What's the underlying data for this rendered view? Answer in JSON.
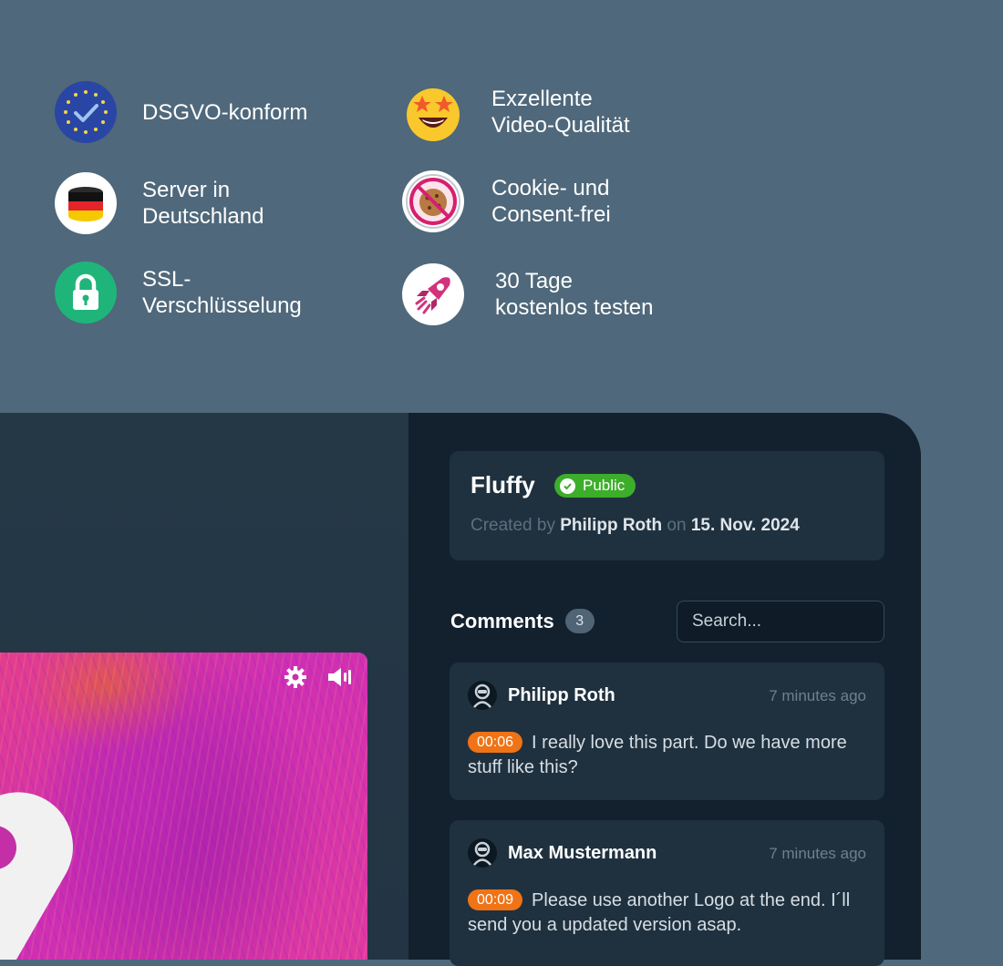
{
  "features": [
    {
      "text": "DSGVO-konform",
      "icon": "eu-shield-icon"
    },
    {
      "text": "Exzellente\nVideo-Qualität",
      "icon": "star-eyes-emoji-icon"
    },
    {
      "text": "Server in\nDeutschland",
      "icon": "german-flag-icon"
    },
    {
      "text": "Cookie- und\nConsent-frei",
      "icon": "no-cookie-icon"
    },
    {
      "text": "SSL-\nVerschlüsselung",
      "icon": "lock-icon"
    },
    {
      "text": "30 Tage\nkostenlos testen",
      "icon": "rocket-icon"
    }
  ],
  "video": {
    "title": "Fluffy",
    "status": "Public",
    "created_prefix": "Created by",
    "author": "Philipp Roth",
    "on": "on",
    "date": "15. Nov. 2024"
  },
  "comments": {
    "label": "Comments",
    "count": "3",
    "search_placeholder": "Search...",
    "items": [
      {
        "author": "Philipp Roth",
        "time": "7 minutes ago",
        "timestamp": "00:06",
        "text": "I really love this part. Do we have more stuff like this?"
      },
      {
        "author": "Max Mustermann",
        "time": "7 minutes ago",
        "timestamp": "00:09",
        "text": "Please use another Logo at the end. I´ll send you a updated version asap."
      }
    ]
  },
  "colors": {
    "background": "#4f687b",
    "panel": "#13202d",
    "card": "#1f313f",
    "public_badge": "#3cae2a",
    "timestamp": "#f07315"
  }
}
